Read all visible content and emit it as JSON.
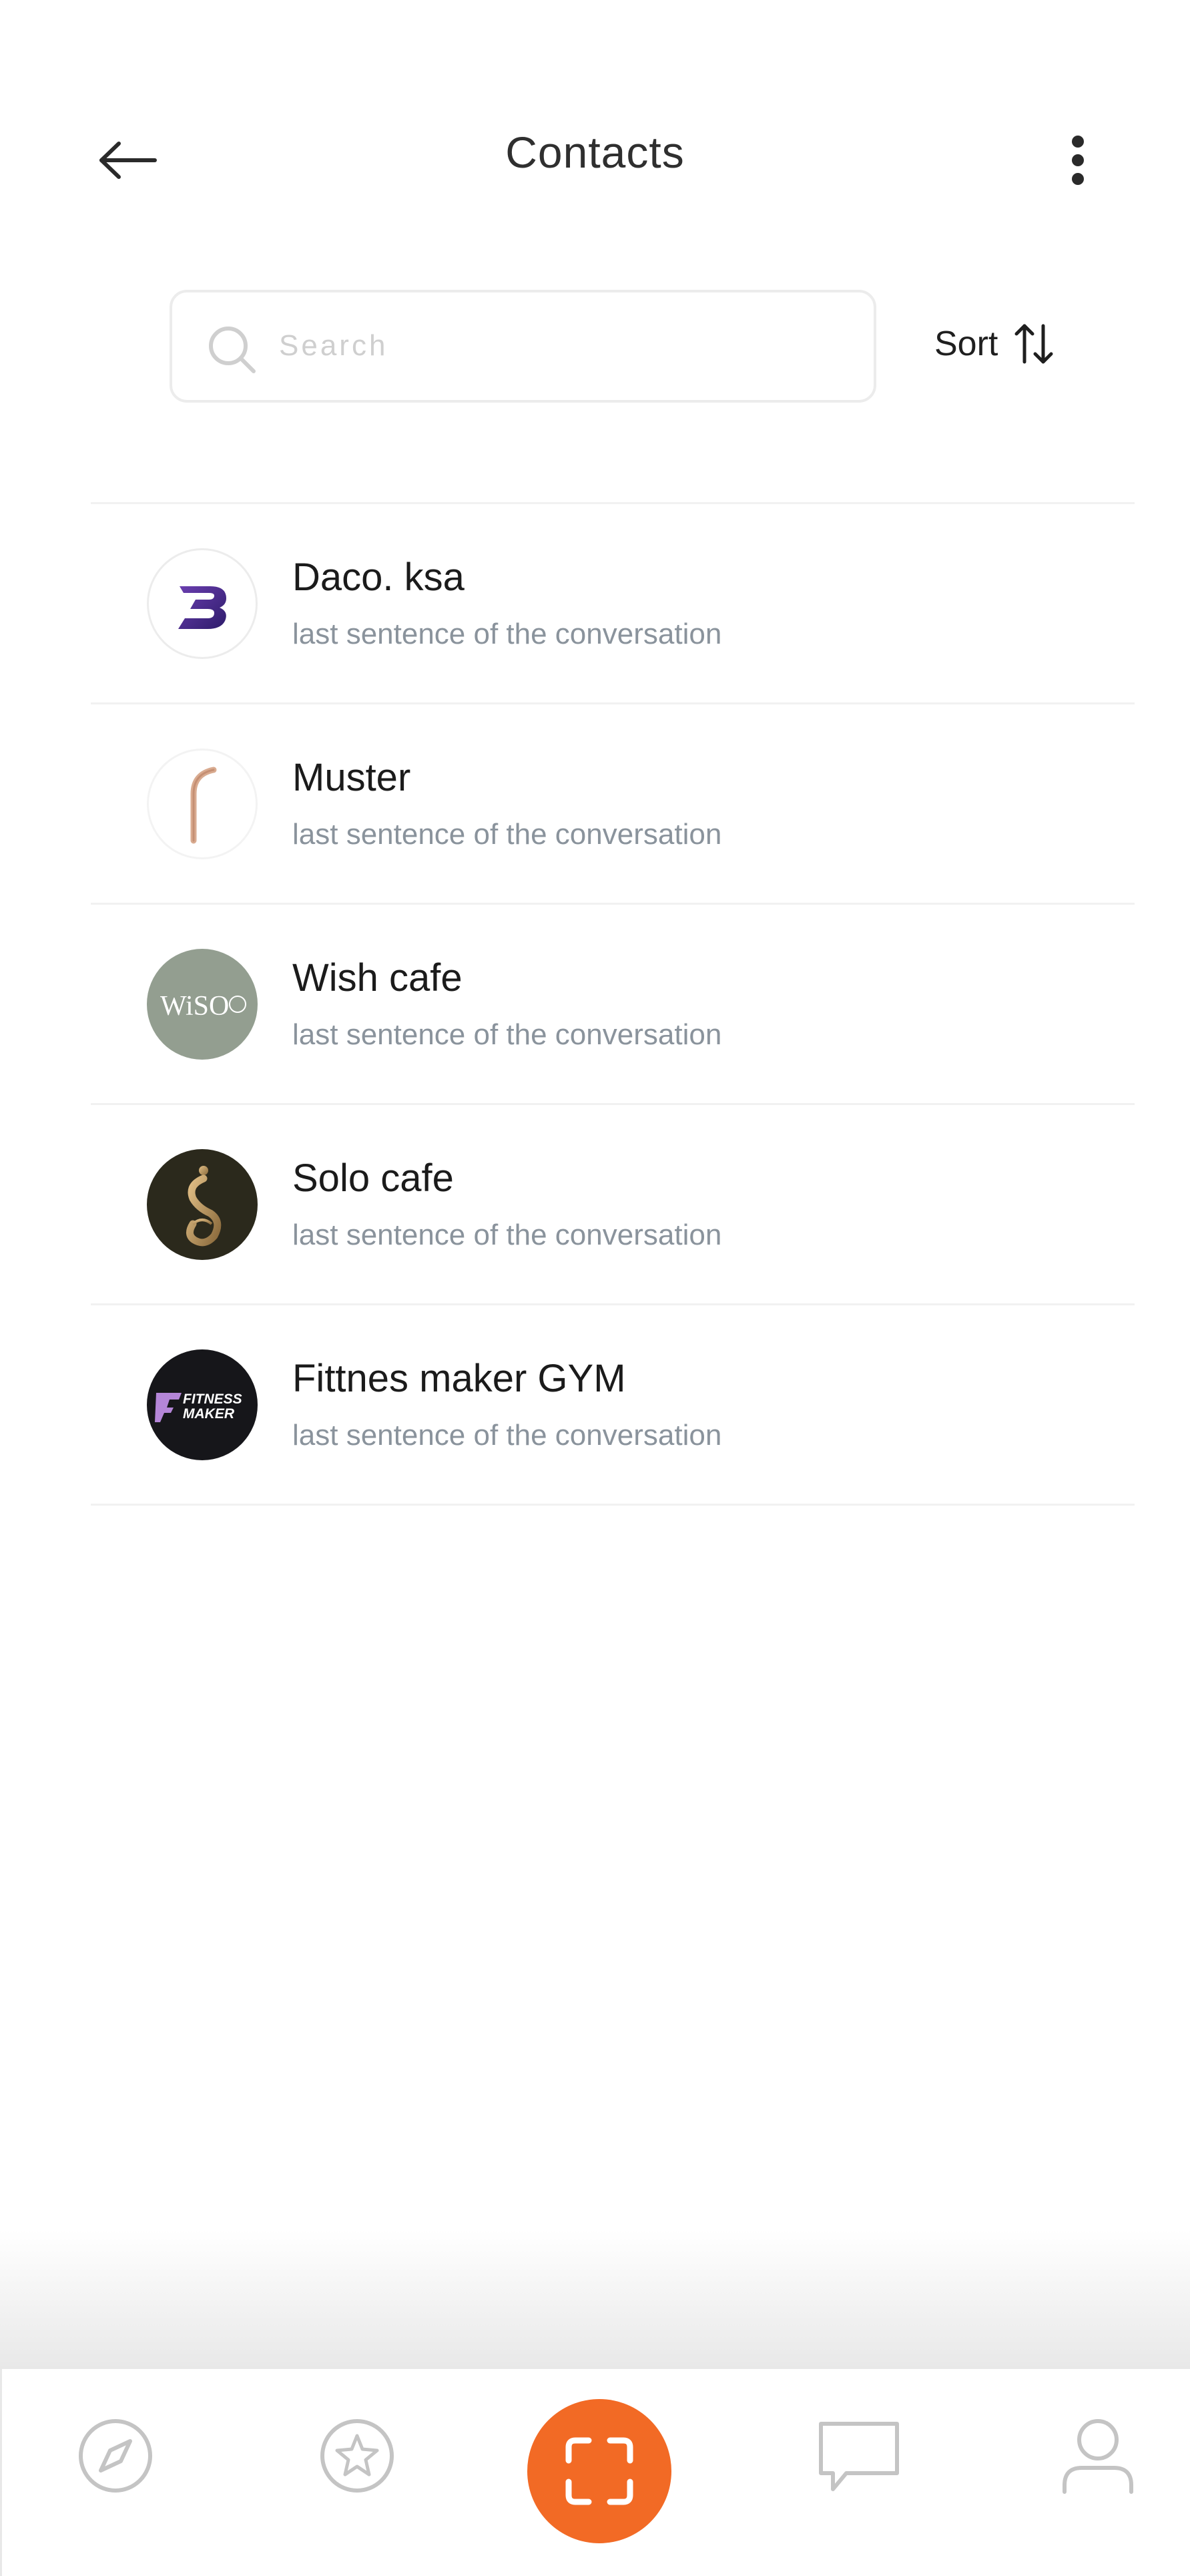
{
  "header": {
    "title": "Contacts",
    "back_icon": "arrow-left-icon",
    "more_icon": "more-vertical-icon"
  },
  "search": {
    "placeholder": "Search",
    "value": "",
    "icon": "search-icon"
  },
  "sort": {
    "label": "Sort",
    "icon": "sort-arrows-icon"
  },
  "contacts": [
    {
      "name": "Daco. ksa",
      "last_message": "last sentence of the conversation",
      "avatar": "daco-logo"
    },
    {
      "name": "Muster",
      "last_message": "last sentence of the conversation",
      "avatar": "muster-logo"
    },
    {
      "name": "Wish cafe",
      "last_message": "last sentence of the conversation",
      "avatar": "wish-cafe-logo",
      "logo_text": "WiSO"
    },
    {
      "name": "Solo cafe",
      "last_message": "last sentence of the conversation",
      "avatar": "solo-cafe-logo"
    },
    {
      "name": "Fittnes maker GYM",
      "last_message": "last sentence of the conversation",
      "avatar": "fitness-maker-logo",
      "logo_text_1": "FITNESS",
      "logo_text_2": "MAKER"
    }
  ],
  "bottom_nav": {
    "items": [
      "compass-icon",
      "star-icon",
      "scan-icon",
      "chat-icon",
      "profile-icon"
    ],
    "accent_color": "#f26a25"
  },
  "colors": {
    "accent": "#f26a25",
    "subtitle": "#8a939c",
    "divider": "#f1f1f1"
  }
}
